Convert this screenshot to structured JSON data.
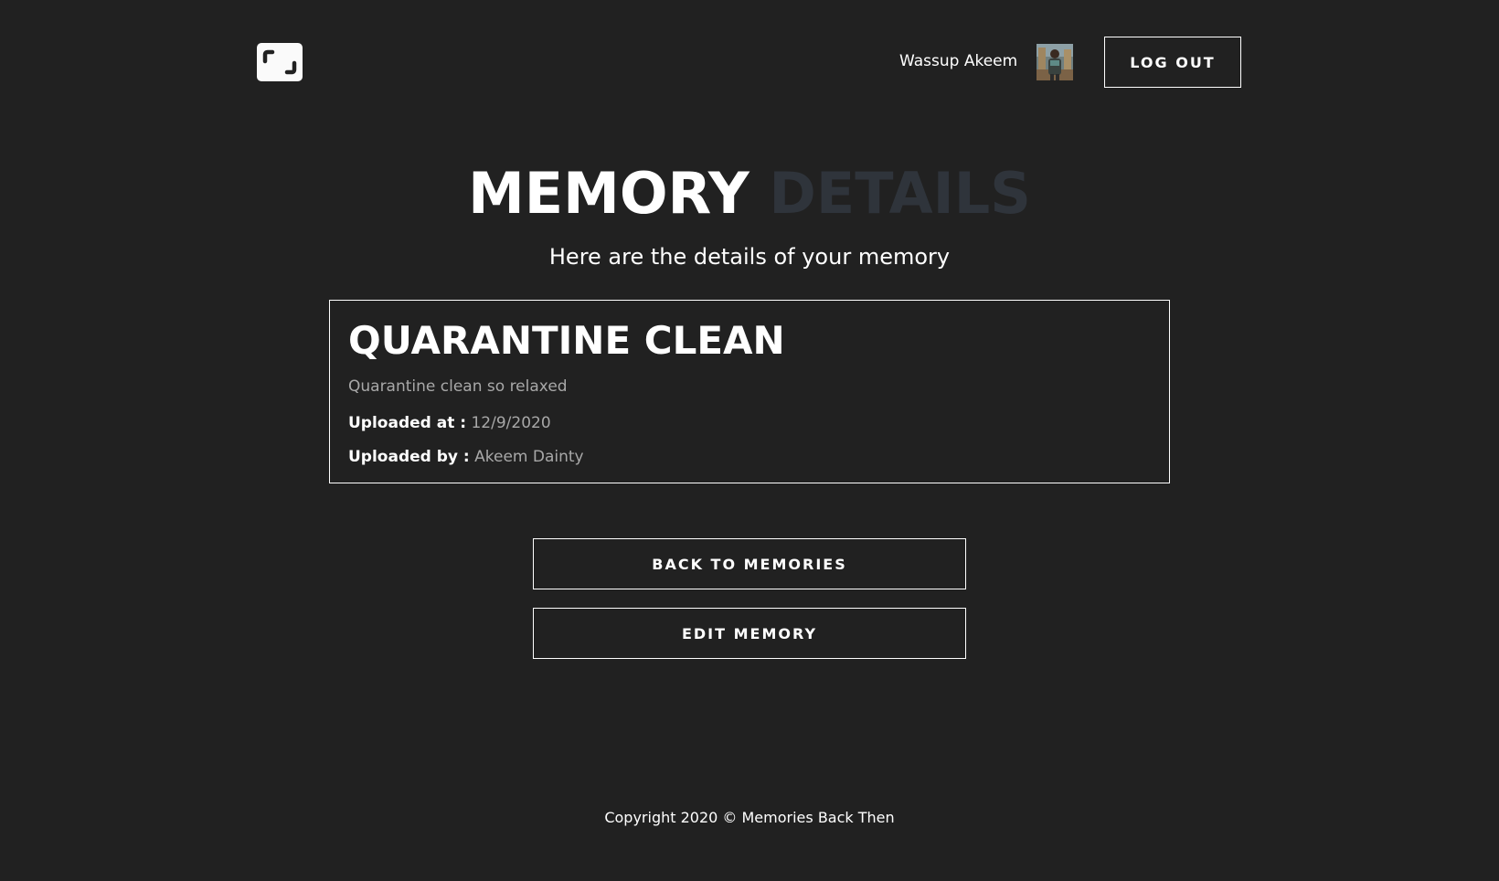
{
  "header": {
    "logo_icon": "bracket-frame-icon",
    "greeting": "Wassup Akeem",
    "avatar_alt": "user-avatar",
    "logout_label": "LOG OUT"
  },
  "page": {
    "title_primary": "MEMORY",
    "title_secondary": "DETAILS",
    "subtitle": "Here are the details of your memory"
  },
  "memory": {
    "title": "QUARANTINE CLEAN",
    "description": "Quarantine clean so relaxed",
    "uploaded_at_label": "Uploaded at :",
    "uploaded_at": "12/9/2020",
    "uploaded_by_label": "Uploaded by :",
    "uploaded_by": "Akeem Dainty"
  },
  "actions": {
    "back_label": "BACK TO MEMORIES",
    "edit_label": "EDIT MEMORY"
  },
  "footer": {
    "copyright": "Copyright 2020 © Memories Back Then"
  },
  "colors": {
    "background": "#212121",
    "text": "#ffffff",
    "muted_text": "#a8a8a8",
    "title_accent": "#2f343b"
  }
}
